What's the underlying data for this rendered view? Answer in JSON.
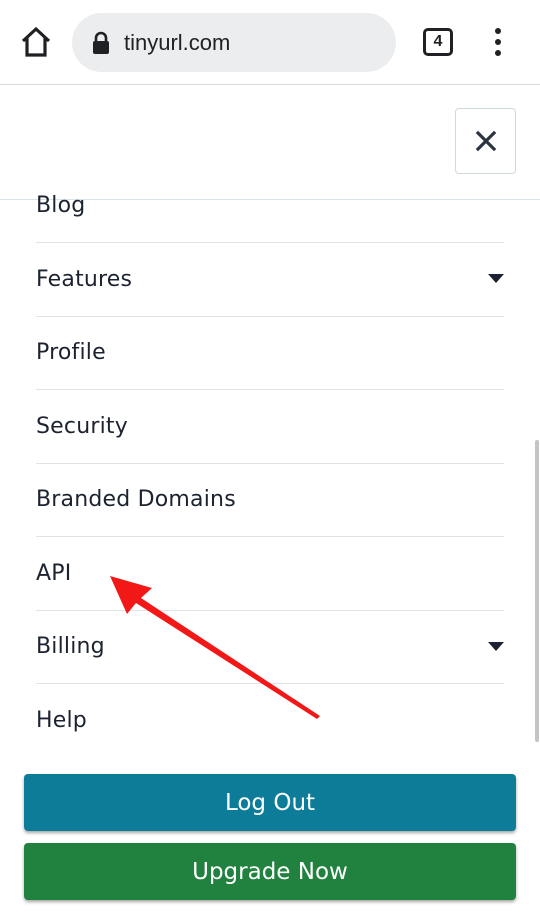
{
  "browser": {
    "url": "tinyurl.com",
    "tab_count": "4",
    "icons": {
      "home": "home-icon",
      "lock": "lock-icon",
      "tabs": "tab-switcher-icon",
      "more": "more-vert-icon"
    }
  },
  "menu": {
    "close_icon": "close-icon",
    "items": [
      {
        "label": "Blog",
        "has_dropdown": false
      },
      {
        "label": "Features",
        "has_dropdown": true
      },
      {
        "label": "Profile",
        "has_dropdown": false
      },
      {
        "label": "Security",
        "has_dropdown": false
      },
      {
        "label": "Branded Domains",
        "has_dropdown": false
      },
      {
        "label": "API",
        "has_dropdown": false
      },
      {
        "label": "Billing",
        "has_dropdown": true
      },
      {
        "label": "Help",
        "has_dropdown": false
      }
    ]
  },
  "actions": {
    "logout_label": "Log Out",
    "upgrade_label": "Upgrade Now"
  },
  "colors": {
    "logout_bg": "#0d7c99",
    "upgrade_bg": "#21813e",
    "annotation_arrow": "#f21818"
  }
}
